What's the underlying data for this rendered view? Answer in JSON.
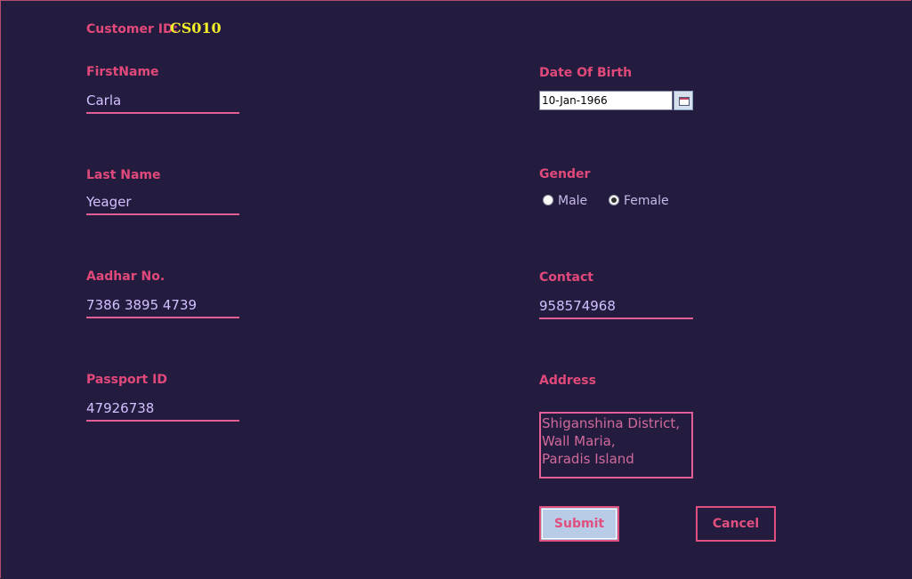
{
  "customer": {
    "id_label": "Customer ID:",
    "id_value": "CS010"
  },
  "left": {
    "first_name": {
      "label": "FirstName",
      "value": "Carla"
    },
    "last_name": {
      "label": "Last Name",
      "value": "Yeager"
    },
    "aadhar": {
      "label": "Aadhar No.",
      "value": "7386 3895 4739"
    },
    "passport": {
      "label": "Passport ID",
      "value": "47926738"
    }
  },
  "right": {
    "dob": {
      "label": "Date Of Birth",
      "value": "10-Jan-1966",
      "picker_icon": "calendar-icon"
    },
    "gender": {
      "label": "Gender",
      "options": [
        {
          "label": "Male",
          "checked": false
        },
        {
          "label": "Female",
          "checked": true
        }
      ]
    },
    "contact": {
      "label": "Contact",
      "value": "958574968"
    },
    "address": {
      "label": "Address",
      "value": "Shiganshina District,\nWall Maria,\nParadis Island"
    }
  },
  "actions": {
    "submit_label": "Submit",
    "cancel_label": "Cancel"
  },
  "colors": {
    "background": "#241c3f",
    "label": "#e1497a",
    "value": "#d3c0ff",
    "accent_yellow": "#f3ee2a",
    "submit_bg": "#b8cce8"
  }
}
